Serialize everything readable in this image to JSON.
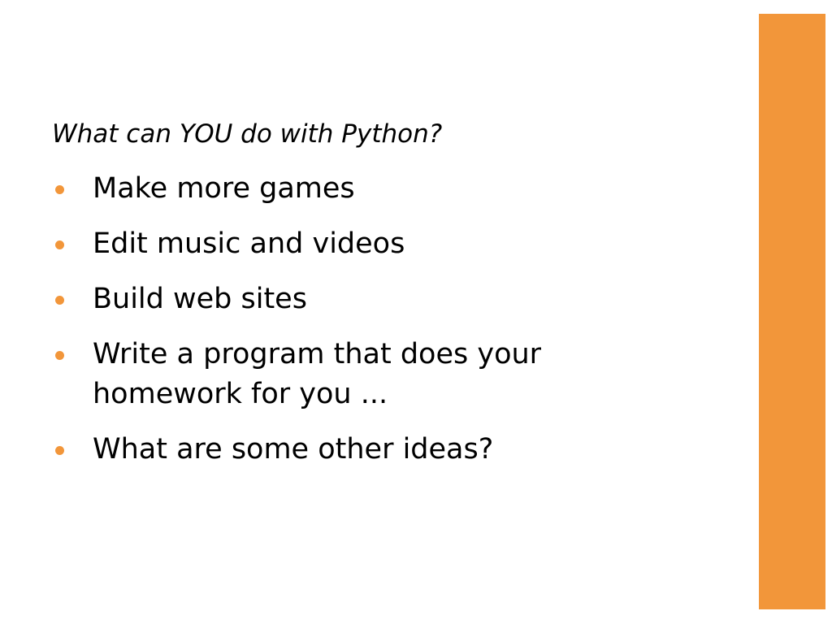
{
  "slide": {
    "subtitle": "What can YOU do with Python?",
    "bullets": [
      {
        "text": "Make more games"
      },
      {
        "text": "Edit music and videos"
      },
      {
        "text": "Build web sites"
      },
      {
        "text": "Write a program that does your homework for you ..."
      },
      {
        "text": "What are some other ideas?"
      }
    ]
  },
  "colors": {
    "accent": "#F2963A",
    "bullet": "#F2963A",
    "text": "#000000",
    "background": "#FFFFFF"
  }
}
